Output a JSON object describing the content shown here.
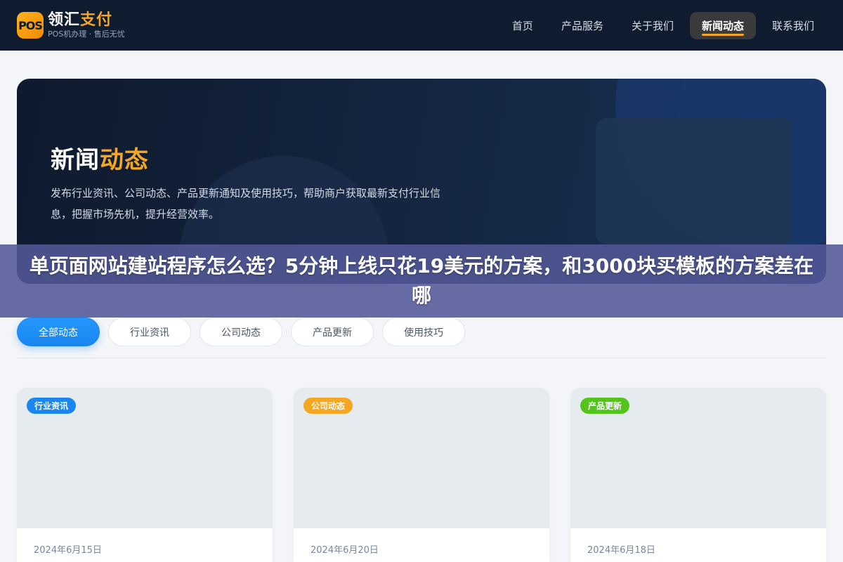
{
  "header": {
    "logo_mark": "POS",
    "logo_name_main": "领汇",
    "logo_name_accent": "支付",
    "logo_sub": "POS机办理 · 售后无忧",
    "nav": [
      {
        "label": "首页",
        "active": false
      },
      {
        "label": "产品服务",
        "active": false
      },
      {
        "label": "关于我们",
        "active": false
      },
      {
        "label": "新闻动态",
        "active": true
      },
      {
        "label": "联系我们",
        "active": false
      }
    ]
  },
  "hero": {
    "title_main": "新闻",
    "title_accent": "动态",
    "description": "发布行业资讯、公司动态、产品更新通知及使用技巧，帮助商户获取最新支付行业信息，把握市场先机，提升经营效率。"
  },
  "overlay": {
    "text": "单页面网站建站程序怎么选？5分钟上线只花19美元的方案，和3000块买模板的方案差在哪"
  },
  "filters": [
    {
      "label": "全部动态",
      "active": true
    },
    {
      "label": "行业资讯",
      "active": false
    },
    {
      "label": "公司动态",
      "active": false
    },
    {
      "label": "产品更新",
      "active": false
    },
    {
      "label": "使用技巧",
      "active": false
    }
  ],
  "cards": [
    {
      "tag": "行业资讯",
      "tag_color": "#1a86f0",
      "date": "2024年6月15日"
    },
    {
      "tag": "公司动态",
      "tag_color": "#f5a623",
      "date": "2024年6月20日"
    },
    {
      "tag": "产品更新",
      "tag_color": "#52c41a",
      "date": "2024年6月18日"
    }
  ],
  "colors": {
    "header_bg": "#0f1b2e",
    "accent": "#f5a623",
    "primary": "#1a86f0"
  }
}
